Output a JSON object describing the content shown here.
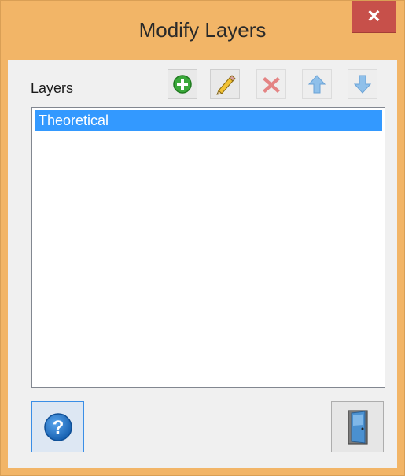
{
  "window": {
    "title": "Modify Layers",
    "close_label": "✕"
  },
  "layers": {
    "label_mnemonic": "L",
    "label_rest": "ayers",
    "items": [
      {
        "label": "Theoretical",
        "selected": true
      }
    ]
  },
  "toolbar": {
    "buttons": [
      {
        "name": "add-layer-button",
        "icon": "plus-circle-icon",
        "enabled": true
      },
      {
        "name": "edit-layer-button",
        "icon": "pencil-icon",
        "enabled": true
      },
      {
        "name": "delete-layer-button",
        "icon": "red-x-icon",
        "enabled": false
      },
      {
        "name": "move-up-button",
        "icon": "arrow-up-icon",
        "enabled": false
      },
      {
        "name": "move-down-button",
        "icon": "arrow-down-icon",
        "enabled": false
      }
    ]
  },
  "colors": {
    "title_bar": "#f2b567",
    "close_button": "#c7504a",
    "selection": "#3399ff",
    "help": "#1e74c8"
  },
  "footer": {
    "help_icon": "question-mark-icon",
    "exit_icon": "exit-door-icon"
  }
}
